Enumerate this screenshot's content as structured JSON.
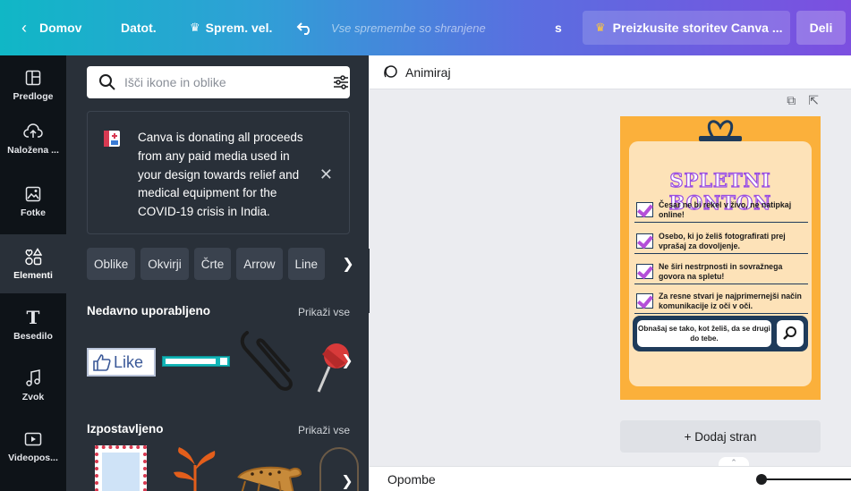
{
  "topbar": {
    "home_label": "Domov",
    "file_label": "Datot.",
    "resize_label": "Sprem. vel.",
    "status_text": "Vse spremembe so shranjene",
    "s_label": "s",
    "upgrade_label": "Preizkusite storitev Canva ...",
    "share_label": "Deli"
  },
  "rail": {
    "items": [
      {
        "label": "Predloge",
        "icon": "templates-icon"
      },
      {
        "label": "Naložena ...",
        "icon": "upload-cloud-icon"
      },
      {
        "label": "Fotke",
        "icon": "photo-icon"
      },
      {
        "label": "Elementi",
        "icon": "elements-icon"
      },
      {
        "label": "Besedilo",
        "icon": "text-icon"
      },
      {
        "label": "Zvok",
        "icon": "music-note-icon"
      },
      {
        "label": "Videopos...",
        "icon": "video-icon"
      }
    ]
  },
  "panel": {
    "search_placeholder": "Išči ikone in oblike",
    "notice_text": "Canva is donating all proceeds from any paid media used in your design towards relief and medical equipment for the COVID-19 crisis in India.",
    "chips": [
      "Oblike",
      "Okvirji",
      "Črte",
      "Arrow",
      "Line"
    ],
    "recent_title": "Nedavno uporabljeno",
    "recent_link": "Prikaži vse",
    "like_text": "Like",
    "featured_title": "Izpostavljeno",
    "featured_link": "Prikaži vse"
  },
  "workspace": {
    "animate_label": "Animiraj",
    "add_page_label": "+ Dodaj stran",
    "notes_label": "Opombe"
  },
  "design": {
    "title": "SPLETNI BONTON",
    "rules": [
      "Česar ne bi rekel v živo, ne natipkaj online!",
      "Osebo, ki jo želiš fotografirati prej vprašaj za dovoljenje.",
      "Ne širi nestrpnosti in sovražnega govora na spletu!",
      "Za resne stvari je najprimernejši način komunikacije iz oči v oči."
    ],
    "search_text": "Obnašaj se tako, kot želiš, da se drugi do tebe."
  },
  "colors": {
    "accent_teal": "#10b7c6",
    "accent_purple": "#7c4fe0",
    "panel_bg": "#293039",
    "rail_bg": "#0e1318",
    "design_orange": "#fbb03b",
    "design_navy": "#1f3b5a",
    "check_purple": "#b44fd8"
  }
}
